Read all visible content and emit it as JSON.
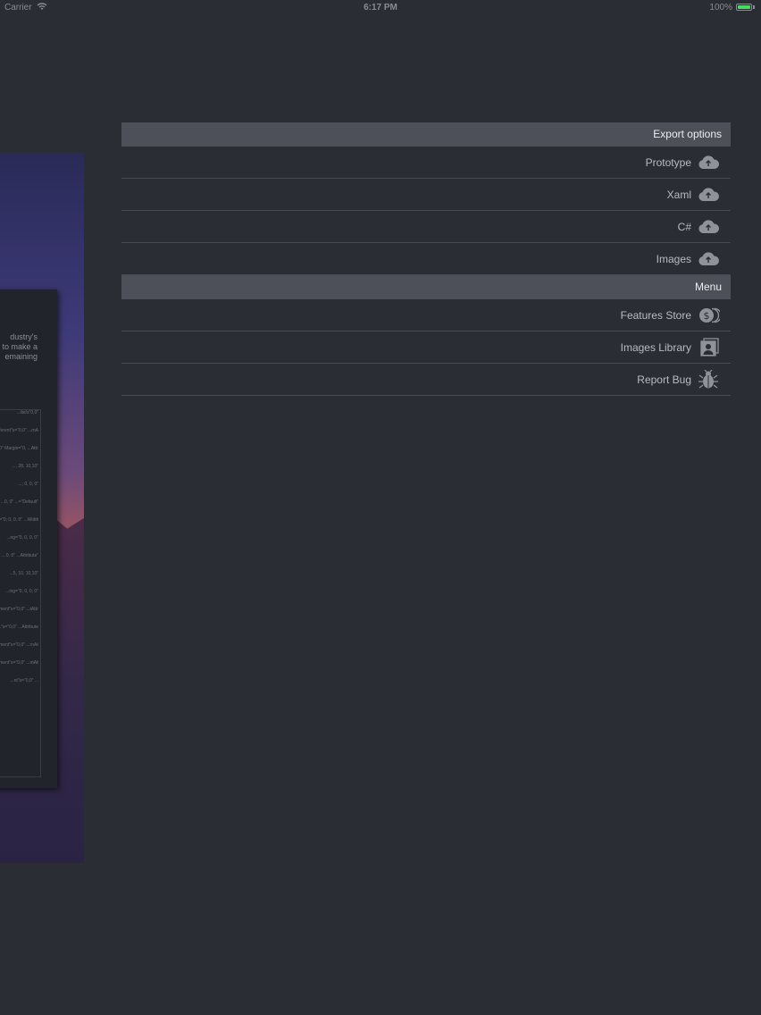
{
  "status_bar": {
    "carrier": "Carrier",
    "time": "6:17 PM",
    "battery": "100%",
    "battery_level": 1.0
  },
  "preview": {
    "doc_text": [
      "dustry's",
      "to make a",
      "emaining"
    ],
    "code_lines": [
      "...ilst/s\"0,0\"",
      "...ferent\"s=\"0,0\" ...rnAttribute",
      "...0\" Margin=\"0, ...Attribute\"",
      "..., 28, 10,10\"",
      "...; 0, 0, 0\"",
      "...0, 0\" ...=\"Default\"",
      "...=\"0, 0, 0, 0\" ...Width\"Default\"",
      "...ng=\"0, 0, 0, 0\"",
      "... 0, 0\" ...Attribute\"",
      "...5, 10, 10,10\"",
      "...ing=\"0, 0, 0, 0\"",
      "...ment\"s=\"0,0\" ...tAttribute",
      "...\"s=\"0,0\" ...Attribute",
      "...ment\"s=\"0,0\" ...rnAttribute",
      "...ment\"s=\"0,0\" ...ntAttribute",
      "...nt\"s=\"0,0\" ..."
    ]
  },
  "export_section": {
    "title": "Export options",
    "items": [
      {
        "label": "Prototype",
        "icon": "cloud-upload-icon"
      },
      {
        "label": "Xaml",
        "icon": "cloud-upload-icon"
      },
      {
        "label": "C#",
        "icon": "cloud-upload-icon"
      },
      {
        "label": "Images",
        "icon": "cloud-upload-icon"
      }
    ]
  },
  "menu_section": {
    "title": "Menu",
    "items": [
      {
        "label": "Features Store",
        "icon": "coins-icon"
      },
      {
        "label": "Images Library",
        "icon": "photo-library-icon"
      },
      {
        "label": "Report Bug",
        "icon": "bug-icon"
      }
    ]
  },
  "colors": {
    "background": "#2b2d34",
    "section_header": "#4d5058",
    "row_text": "#b9bbc1",
    "icon": "#8f9299",
    "battery": "#4cd964"
  }
}
